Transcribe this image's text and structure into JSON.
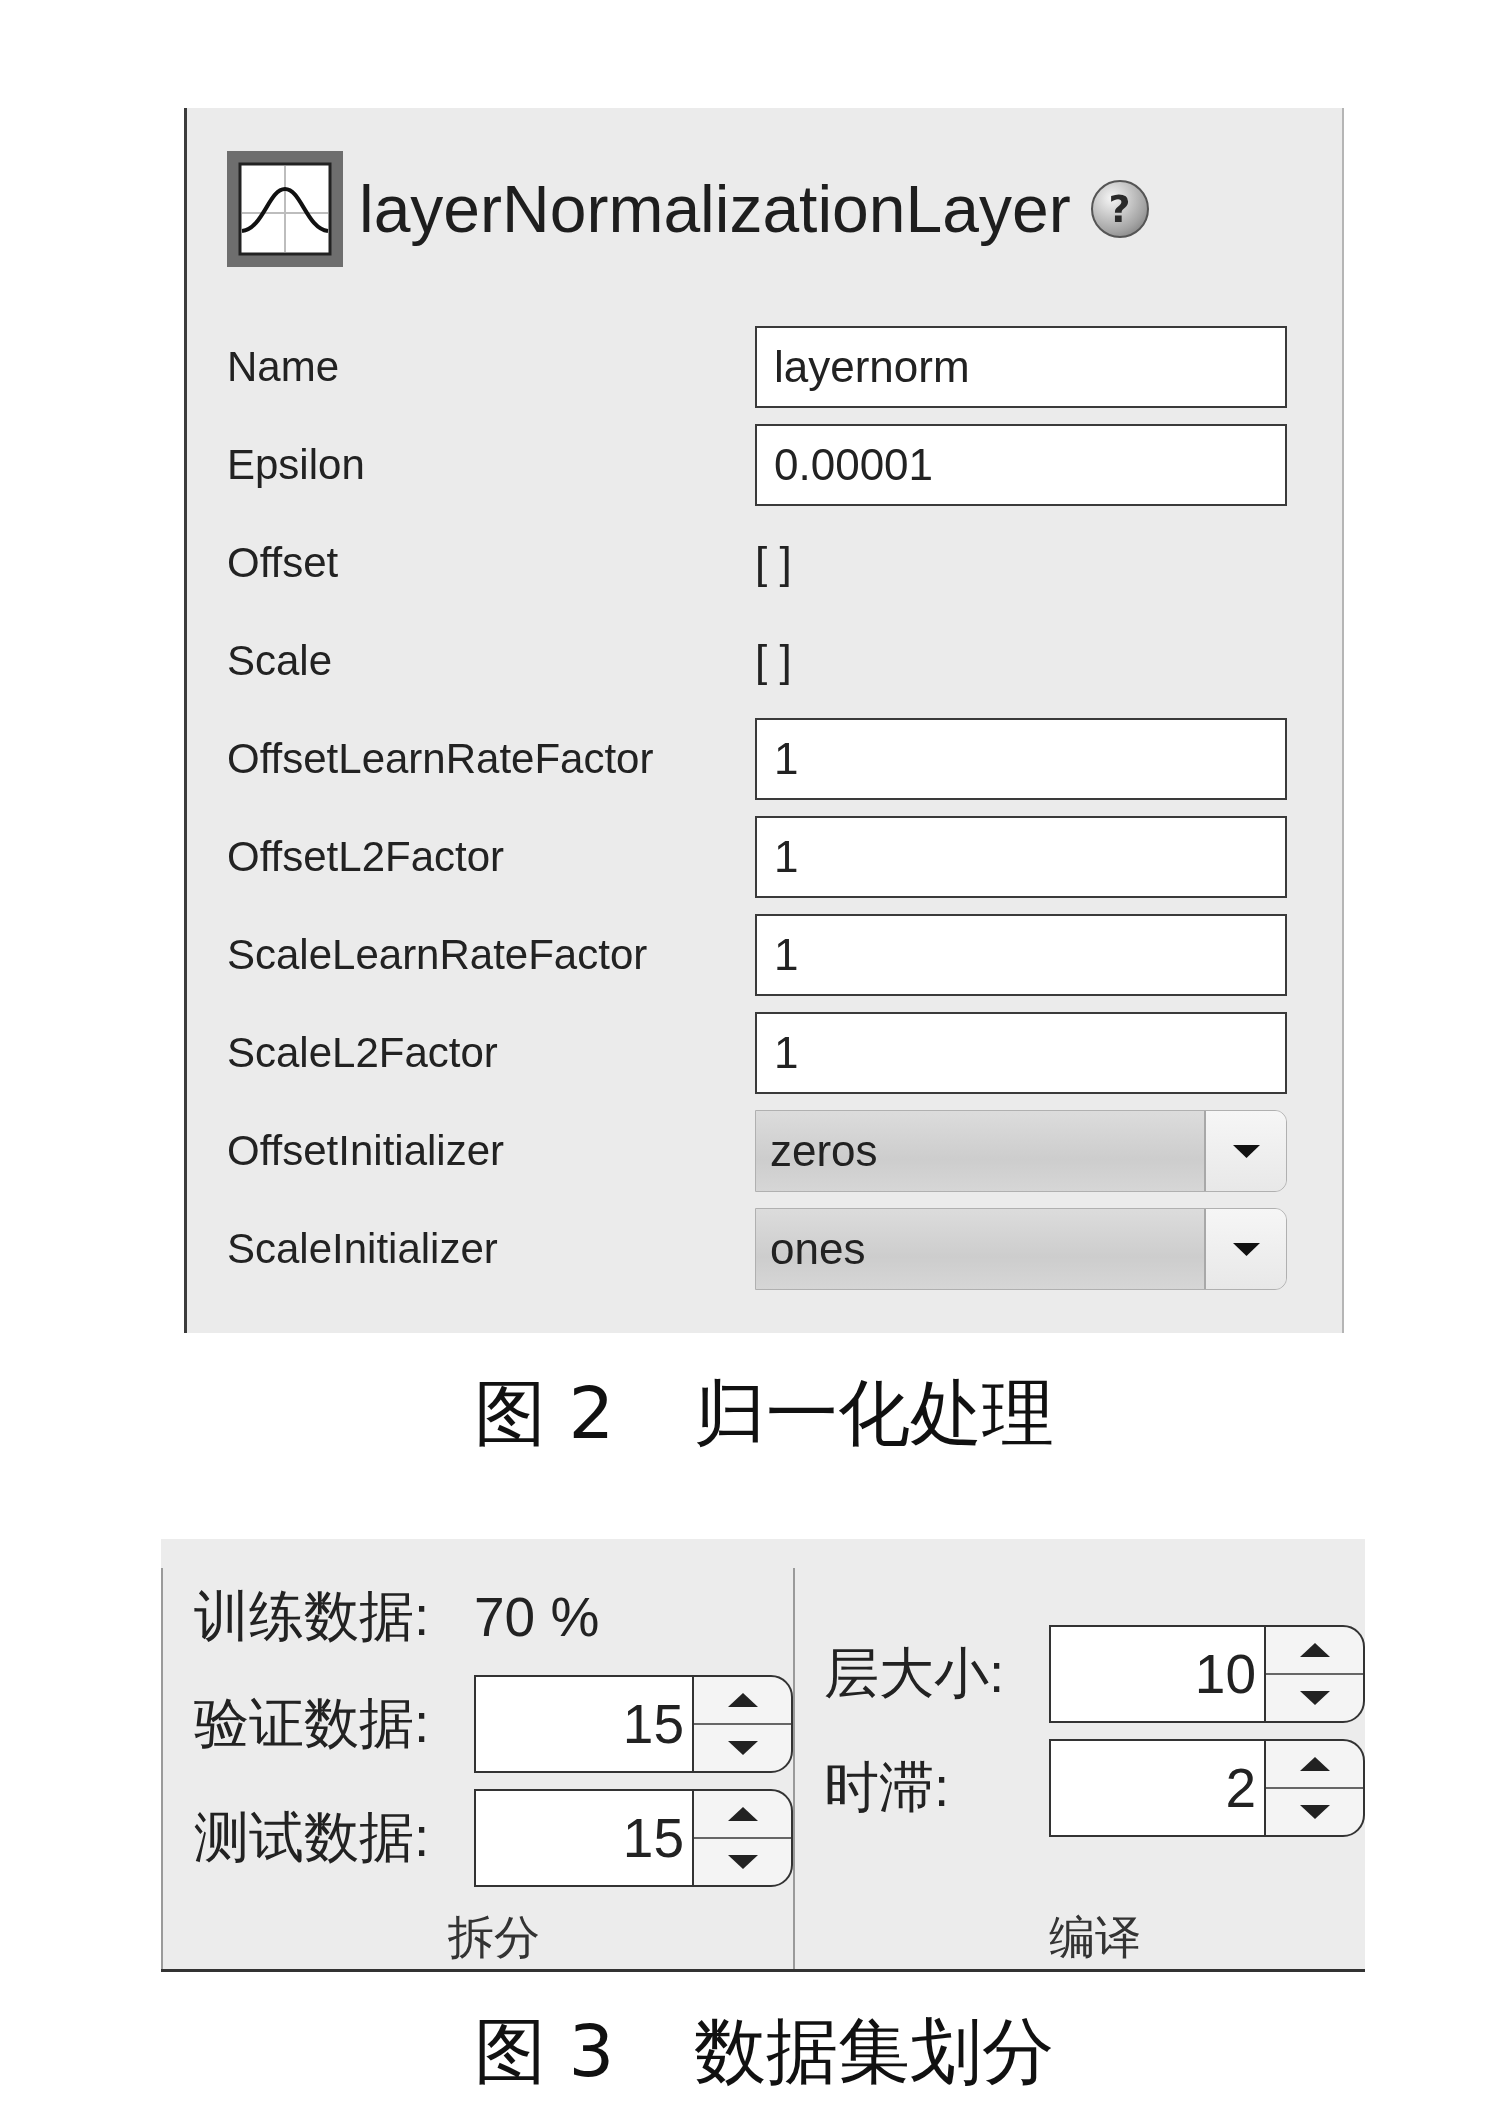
{
  "figure_2": {
    "panel": {
      "title": "layerNormalizationLayer",
      "help": "?",
      "properties": [
        {
          "kind": "text",
          "label": "Name",
          "value": "layernorm"
        },
        {
          "kind": "text",
          "label": "Epsilon",
          "value": "0.00001"
        },
        {
          "kind": "static",
          "label": "Offset",
          "value": "[ ]"
        },
        {
          "kind": "static",
          "label": "Scale",
          "value": "[ ]"
        },
        {
          "kind": "text",
          "label": "OffsetLearnRateFactor",
          "value": "1"
        },
        {
          "kind": "text",
          "label": "OffsetL2Factor",
          "value": "1"
        },
        {
          "kind": "text",
          "label": "ScaleLearnRateFactor",
          "value": "1"
        },
        {
          "kind": "text",
          "label": "ScaleL2Factor",
          "value": "1"
        },
        {
          "kind": "dropdown",
          "label": "OffsetInitializer",
          "value": "zeros"
        },
        {
          "kind": "dropdown",
          "label": "ScaleInitializer",
          "value": "ones"
        }
      ]
    },
    "caption": {
      "number": "图 2",
      "text": "归一化处理"
    }
  },
  "figure_3": {
    "groups": [
      {
        "title": "拆分",
        "rows": [
          {
            "kind": "static",
            "label": "训练数据:",
            "value": "70 %"
          },
          {
            "kind": "spinner",
            "label": "验证数据:",
            "value": "15"
          },
          {
            "kind": "spinner",
            "label": "测试数据:",
            "value": "15"
          }
        ]
      },
      {
        "title": "编译",
        "rows": [
          {
            "kind": "spinner",
            "label": "层大小:",
            "value": "10"
          },
          {
            "kind": "spinner",
            "label": "时滞:",
            "value": "2"
          }
        ]
      }
    ],
    "caption": {
      "number": "图 3",
      "text": "数据集划分"
    }
  }
}
